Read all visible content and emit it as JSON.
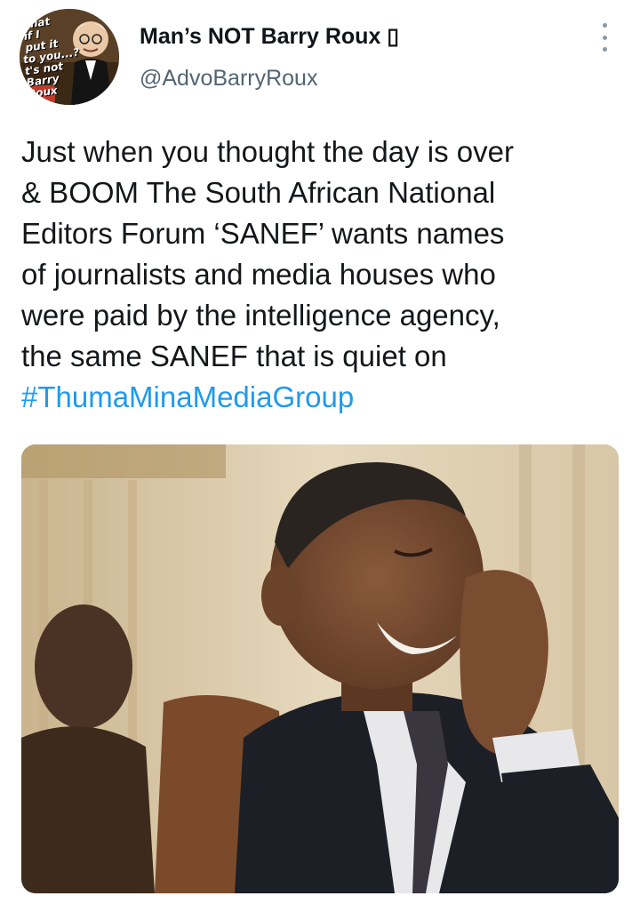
{
  "author": {
    "display_name": "Man’s NOT Barry Roux ▯",
    "handle": "@AdvoBarryRoux",
    "avatar_caption": "What\n if I\n put it\nto you...?\nt's not\nBarry\nRoux"
  },
  "tweet": {
    "lines": [
      "Just when you thought the day is over",
      "& BOOM The South African National",
      "Editors Forum ‘SANEF’ wants names",
      "of journalists and media houses who",
      "were paid by the intelligence agency,",
      "the same SANEF that is quiet on"
    ],
    "hashtag": "#ThumaMinaMediaGroup"
  },
  "colors": {
    "hashtag": "#1d9bf0",
    "handle": "#536471",
    "text": "#14171a"
  }
}
